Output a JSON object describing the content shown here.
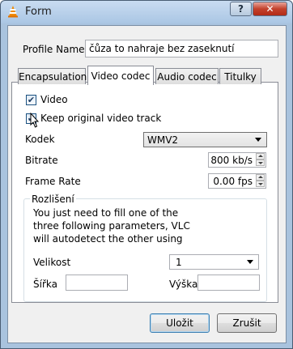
{
  "window": {
    "title": "Form",
    "help_label": "?",
    "close_label": "✕",
    "icon": "vlc-cone-icon"
  },
  "profile": {
    "label": "Profile Name",
    "value": "čůza to nahraje bez zaseknutí"
  },
  "tabs": [
    {
      "label": "Encapsulation",
      "active": false
    },
    {
      "label": "Video codec",
      "active": true
    },
    {
      "label": "Audio codec",
      "active": false
    },
    {
      "label": "Titulky",
      "active": false
    }
  ],
  "video": {
    "video_checkbox": {
      "label": "Video",
      "checked": true
    },
    "keep_checkbox": {
      "label": "Keep original video track",
      "checked": true
    },
    "codec": {
      "label": "Kodek",
      "value": "WMV2"
    },
    "bitrate": {
      "label": "Bitrate",
      "value": "800 kb/s"
    },
    "framerate": {
      "label": "Frame Rate",
      "value": "0.00 fps"
    }
  },
  "resolution": {
    "title": "Rozlišení",
    "info": "You just need to fill one of the three following parameters, VLC will autodetect the other using the original aspect ratio",
    "size": {
      "label": "Velikost",
      "value": "1"
    },
    "width": {
      "label": "Šířka",
      "value": ""
    },
    "height": {
      "label": "Výška",
      "value": ""
    }
  },
  "buttons": {
    "save": "Uložit",
    "cancel": "Zrušit"
  },
  "colors": {
    "titlebar": "#aac6e4",
    "close": "#c3412c",
    "focus": "#3c7fb1"
  }
}
